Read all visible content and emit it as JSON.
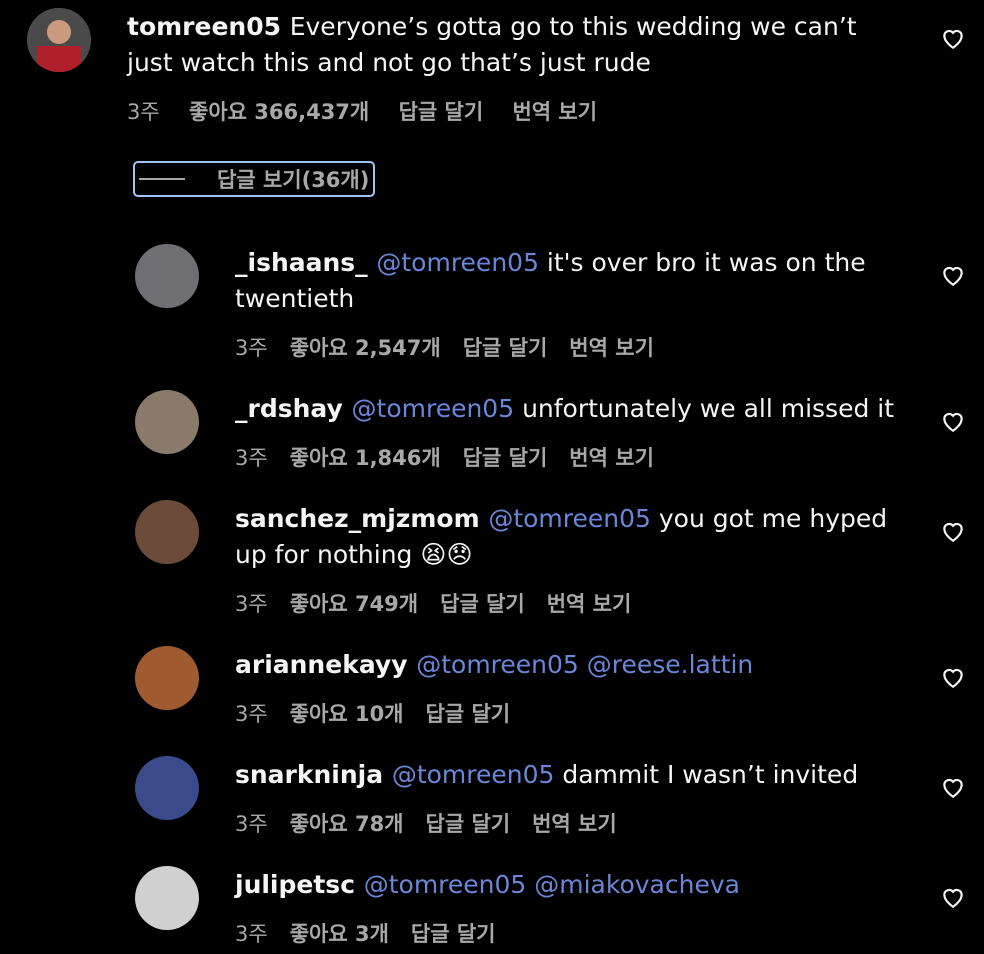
{
  "main_comment": {
    "username": "tomreen05",
    "text": "Everyone’s gotta go to this wedding we can’t just watch this and not go that’s just rude",
    "time": "3주",
    "likes": "좋아요 366,437개",
    "reply": "답글 달기",
    "translate": "번역 보기"
  },
  "view_replies": "답글 보기(36개)",
  "replies": [
    {
      "username": "_ishaans_",
      "mention": "@tomreen05",
      "text": "it's over bro it was on the twentieth",
      "time": "3주",
      "likes": "좋아요 2,547개",
      "reply": "답글 달기",
      "translate": "번역 보기",
      "avatar_color": "#6e6e73"
    },
    {
      "username": "_rdshay",
      "mention": "@tomreen05",
      "text": "unfortunately we all missed it",
      "time": "3주",
      "likes": "좋아요 1,846개",
      "reply": "답글 달기",
      "translate": "번역 보기",
      "avatar_color": "#8a7a6a"
    },
    {
      "username": "sanchez_mjzmom",
      "mention": "@tomreen05",
      "text": "you got me hyped up for nothing 😫😞",
      "time": "3주",
      "likes": "좋아요 749개",
      "reply": "답글 달기",
      "translate": "번역 보기",
      "avatar_color": "#6b4a3a"
    },
    {
      "username": "ariannekayy",
      "mention": "@tomreen05 @reese.lattin",
      "text": "",
      "time": "3주",
      "likes": "좋아요 10개",
      "reply": "답글 달기",
      "translate": "",
      "avatar_color": "#a05a30"
    },
    {
      "username": "snarkninja",
      "mention": "@tomreen05",
      "text": "dammit I wasn’t invited",
      "time": "3주",
      "likes": "좋아요 78개",
      "reply": "답글 달기",
      "translate": "번역 보기",
      "avatar_color": "#3a4a8a"
    },
    {
      "username": "julipetsc",
      "mention": "@tomreen05 @miakovacheva",
      "text": "",
      "time": "3주",
      "likes": "좋아요 3개",
      "reply": "답글 달기",
      "translate": "",
      "avatar_color": "#d0d0d0"
    }
  ]
}
